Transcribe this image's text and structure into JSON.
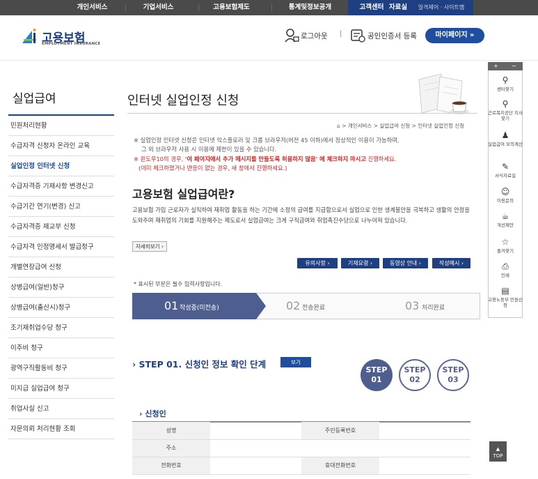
{
  "topnav": {
    "items": [
      "개인서비스",
      "기업서비스",
      "고용보험제도",
      "통계및정보공개"
    ],
    "customer": "고객센터",
    "data_room": "자료실",
    "util": "일격제어 · 사이트맵"
  },
  "header": {
    "logo_text": "고용보험",
    "logo_sub": "EMPLOYMENT INSURANCE",
    "logout": "로그아웃",
    "sep": "|",
    "cert_login": "공인인증서 등록",
    "mypage": "마이페이지  »"
  },
  "sidebar": {
    "title": "실업급여",
    "items": [
      "민원처리현황",
      "수급자격 신청자 온라인 교육",
      "실업인정 인터넷 신청",
      "수급자격증 기재사항 변경신고",
      "수급기간 연기(변경) 신고",
      "수급자격증 재교부 신청",
      "수급자격 인정명세서 발급청구",
      "개별연장급여 신청",
      "상병급여(일반)청구",
      "상병급여(출산시)청구",
      "조기재취업수당 청구",
      "이주비 청구",
      "광역구직활동비 청구",
      "미지급 실업급여 청구",
      "취업사실 신고",
      "자문의뢰 처리현황 조회"
    ]
  },
  "main": {
    "page_title": "인터넷 실업인정 신청",
    "breadcrumb": "⌂ > 개인서비스 > 실업급여 신청 > 인터넷 실업인정 신청",
    "note1": "※ 실업인정 인터넷 신청은 인터넷 익스플로러 및 크롬 브라우저(버전 45 이하)에서 정상적인 이용이 가능하며,",
    "note2": "그 외 브라우저 사용 시 이용에 제한이 있을 수 있습니다.",
    "note3_prefix": "※ 윈도우10의 경우, ",
    "note3_bold": "'이 페이지에서 추가 메시지를 만들도록 허용하지 않음' 에 체크하지 마시고",
    "note3_suffix": " 진행하세요.",
    "note4": "(이미 체크하였거나 반응이 없는 경우, 새 창에서 진행하세요.)",
    "section_title": "고용보험 실업급여란?",
    "section_desc": "고용보험 가입 근로자가 실직하여 재취업 활동을 하는 기간에 소정의 급여를 지급함으로서 실업으로 인한 생계불안을 극복하고 생활의 안정을 도와주며 재취업의 기회를 지원해주는 제도로서 실업급여는 크게 구직급여와 취업촉진수당으로 나누어져 있습니다.",
    "more_btn": "자세히보기 ›",
    "doc_buttons": [
      "유의사항 ›",
      "기재요령 ›",
      "동영상 안내 ›",
      "작성예시 ›"
    ],
    "required_note": "* 표시된 부분은 필수 입력사항입니다.",
    "steps": [
      {
        "num": "01",
        "label": "작성중(미전송)"
      },
      {
        "num": "02",
        "label": "전송완료"
      },
      {
        "num": "03",
        "label": "처리완료"
      }
    ],
    "step01_title": "› STEP 01. 신청인 정보 확인 단계",
    "view_btn": "보기",
    "circles": [
      {
        "top": "STEP",
        "num": "01"
      },
      {
        "top": "STEP",
        "num": "02"
      },
      {
        "top": "STEP",
        "num": "03"
      }
    ],
    "applicant_title": "› 신청인",
    "table": {
      "name": "성명",
      "rrn": "주민등록번호",
      "address": "주소",
      "phone": "전화번호",
      "mobile": "휴대전화번호"
    }
  },
  "quickbar": {
    "plus": "+",
    "minus": "−",
    "items": [
      {
        "icon": "⚲",
        "label": "센터찾기"
      },
      {
        "icon": "⚲",
        "label": "근로복지공단 지사찾기"
      },
      {
        "icon": "♟",
        "label": "실업급여 모의계산"
      },
      {
        "icon": "✎",
        "label": "서식자료실"
      },
      {
        "icon": "☺",
        "label": "이용문의"
      },
      {
        "icon": "☕",
        "label": "개선제안"
      },
      {
        "icon": "☆",
        "label": "즐겨찾기"
      },
      {
        "icon": "⎙",
        "label": "인쇄"
      },
      {
        "icon": "▤",
        "label": "고용노동부 민원신청"
      }
    ],
    "top": "TOP"
  }
}
